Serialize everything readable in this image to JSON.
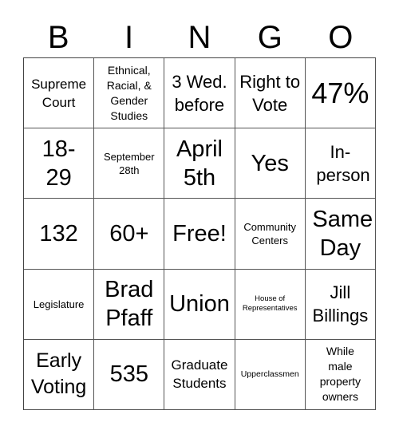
{
  "header": {
    "letters": [
      "B",
      "I",
      "N",
      "G",
      "O"
    ]
  },
  "cells": [
    "Supreme Court",
    "Ethnical, Racial, & Gender Studies",
    "3 Wed. before",
    "Right to Vote",
    "47%",
    "18-29",
    "September 28th",
    "April 5th",
    "Yes",
    "In-person",
    "132",
    "60+",
    "Free!",
    "Community Centers",
    "Same Day",
    "Legislature",
    "Brad Pfaff",
    "Union",
    "House of Representatives",
    "Jill Billings",
    "Early Voting",
    "535",
    "Graduate Students",
    "Upperclassmen",
    "While male property owners"
  ]
}
